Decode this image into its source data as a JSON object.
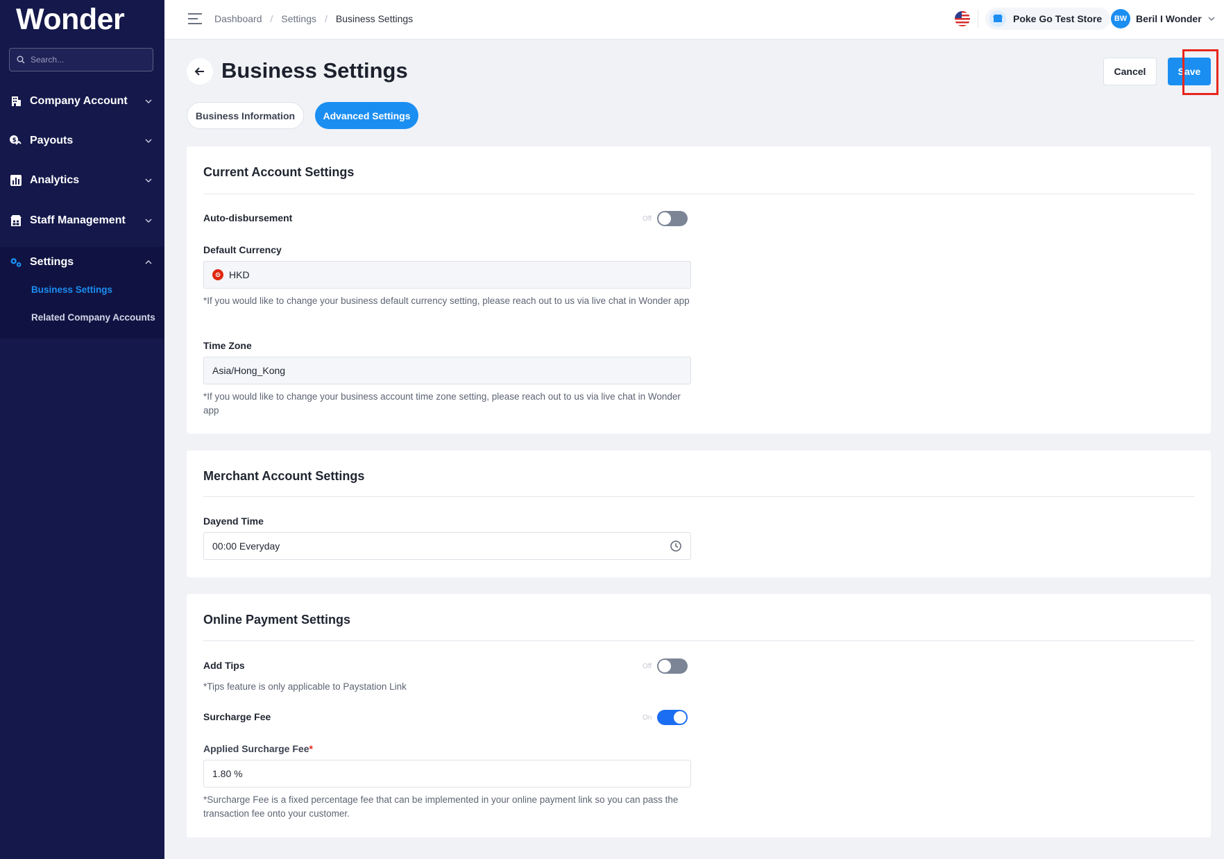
{
  "sidebar": {
    "logo": "Wonder",
    "search_placeholder": "Search...",
    "items": [
      {
        "label": "Company Account"
      },
      {
        "label": "Payouts"
      },
      {
        "label": "Analytics"
      },
      {
        "label": "Staff Management"
      },
      {
        "label": "Settings"
      }
    ],
    "settings_sub": [
      {
        "label": "Business Settings",
        "active": true
      },
      {
        "label": "Related Company Accounts",
        "active": false
      }
    ]
  },
  "topbar": {
    "breadcrumb": [
      "Dashboard",
      "Settings",
      "Business Settings"
    ],
    "store_name": "Poke Go Test Store",
    "user_initials": "BW",
    "user_name": "Beril I Wonder"
  },
  "header": {
    "title": "Business Settings",
    "cancel_label": "Cancel",
    "save_label": "Save"
  },
  "tabs": [
    {
      "label": "Business Information",
      "active": false
    },
    {
      "label": "Advanced Settings",
      "active": true
    }
  ],
  "current_account": {
    "title": "Current Account Settings",
    "auto_disbursement_label": "Auto-disbursement",
    "auto_disbursement_state": "Off",
    "default_currency_label": "Default Currency",
    "default_currency_value": "HKD",
    "currency_hint": "*If you would like to change your business default currency setting, please reach out to us via live chat in Wonder app",
    "timezone_label": "Time Zone",
    "timezone_value": "Asia/Hong_Kong",
    "timezone_hint": "*If you would like to change your business account time zone setting, please reach out to us via live chat in Wonder app"
  },
  "merchant_account": {
    "title": "Merchant Account Settings",
    "dayend_label": "Dayend Time",
    "dayend_value": "00:00 Everyday"
  },
  "online_payment": {
    "title": "Online Payment Settings",
    "add_tips_label": "Add Tips",
    "add_tips_state": "Off",
    "tips_hint": "*Tips feature is only applicable to Paystation Link",
    "surcharge_label": "Surcharge Fee",
    "surcharge_state": "On",
    "applied_surcharge_label": "Applied Surcharge Fee",
    "required_mark": "*",
    "applied_surcharge_value": "1.80 %",
    "surcharge_hint": "*Surcharge Fee is a fixed percentage fee that can be implemented in your online payment link so you can pass the transaction fee onto your customer."
  },
  "colors": {
    "sidebar_bg": "#14184a",
    "accent": "#1b8ef2",
    "highlight": "#e8261c"
  }
}
